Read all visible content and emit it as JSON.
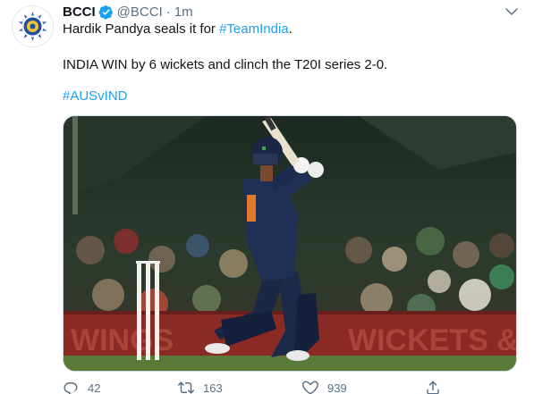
{
  "tweet": {
    "author_name": "BCCI",
    "handle": "@BCCI",
    "separator": "·",
    "time": "1m",
    "line1_prefix": "Hardik Pandya seals it for ",
    "line1_link": "#TeamIndia",
    "line1_suffix": ".",
    "line2": "INDIA WIN by 6 wickets and clinch the T20I series 2-0.",
    "hashtag": "#AUSvIND",
    "media_banner_left": "WINGS",
    "media_banner_right": "WICKETS &"
  },
  "actions": {
    "reply_count": "42",
    "retweet_count": "163",
    "like_count": "939"
  },
  "icons": [
    "bcci-logo-icon",
    "verified-badge-icon",
    "chevron-down-icon",
    "reply-icon",
    "retweet-icon",
    "like-icon",
    "share-icon"
  ],
  "colors": {
    "link": "#1da1f2",
    "secondary": "#5b7083",
    "verified": "#1da1f2"
  }
}
